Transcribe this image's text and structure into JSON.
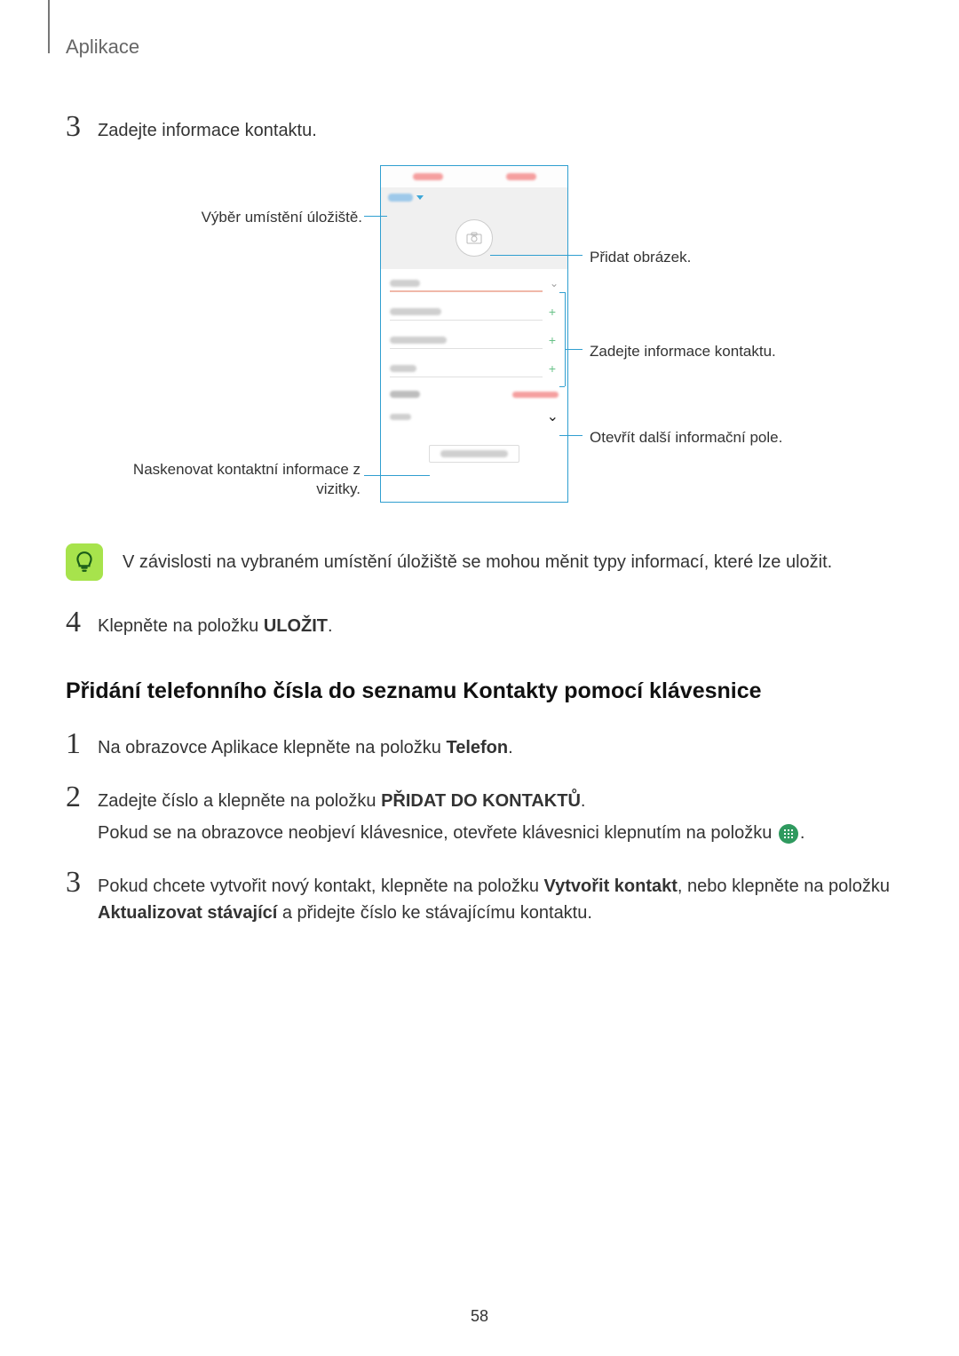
{
  "page": {
    "section_header": "Aplikace",
    "page_number": "58"
  },
  "step3": {
    "num": "3",
    "text": "Zadejte informace kontaktu."
  },
  "callouts": {
    "storage": "Výběr umístění úložiště.",
    "scan_line1": "Naskenovat kontaktní informace z",
    "scan_line2": "vizitky.",
    "add_image": "Přidat obrázek.",
    "enter_info": "Zadejte informace kontaktu.",
    "open_more": "Otevřít další informační pole."
  },
  "note": {
    "text": "V závislosti na vybraném umístění úložiště se mohou měnit typy informací, které lze uložit."
  },
  "step4": {
    "num": "4",
    "pre": "Klepněte na položku ",
    "bold": "ULOŽIT",
    "post": "."
  },
  "heading2": "Přidání telefonního čísla do seznamu Kontakty pomocí klávesnice",
  "stepsB": {
    "s1": {
      "num": "1",
      "pre": "Na obrazovce Aplikace klepněte na položku ",
      "bold": "Telefon",
      "post": "."
    },
    "s2": {
      "num": "2",
      "line1_pre": "Zadejte číslo a klepněte na položku ",
      "line1_bold": "PŘIDAT DO KONTAKTŮ",
      "line1_post": ".",
      "line2_pre": "Pokud se na obrazovce neobjeví klávesnice, otevřete klávesnici klepnutím na položku ",
      "line2_post": "."
    },
    "s3": {
      "num": "3",
      "pre": "Pokud chcete vytvořit nový kontakt, klepněte na položku ",
      "bold1": "Vytvořit kontakt",
      "mid": ", nebo klepněte na položku ",
      "bold2": "Aktualizovat stávající",
      "post": " a přidejte číslo ke stávajícímu kontaktu."
    }
  }
}
